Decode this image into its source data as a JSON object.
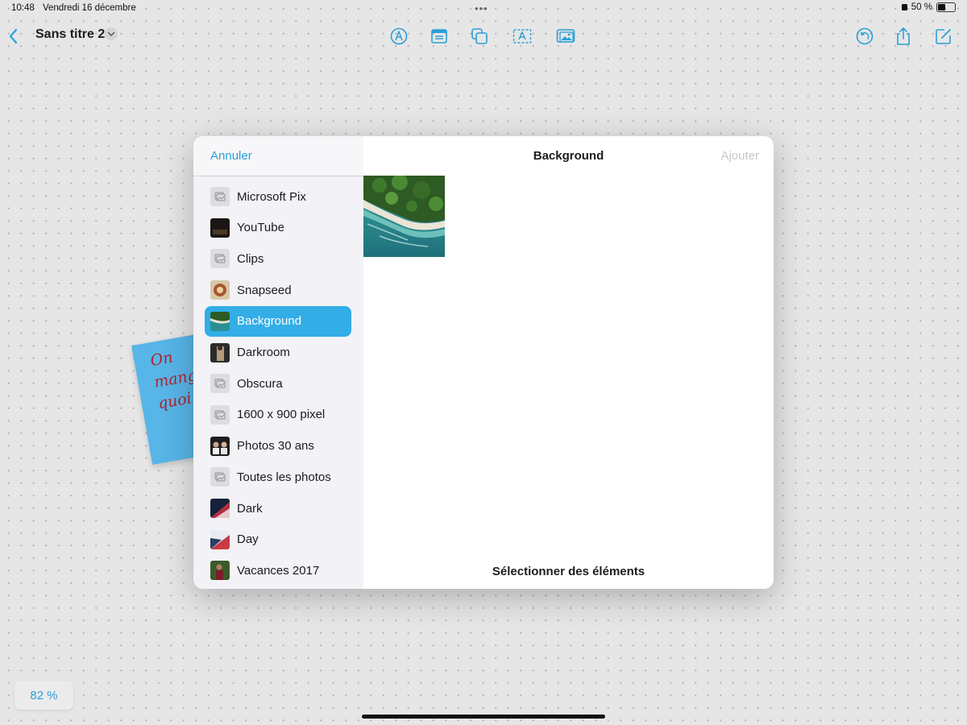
{
  "status": {
    "time": "10:48",
    "date": "Vendredi 16 décembre",
    "battery": "50 %",
    "battery_level": 0.5
  },
  "toolbar": {
    "doc_title": "Sans titre 2",
    "icons": [
      "back-chevron-icon",
      "title-menu-chevron-icon",
      "pen-markup-icon",
      "sticky-note-icon",
      "shapes-icon",
      "text-box-icon",
      "insert-media-icon",
      "history-icon",
      "share-icon",
      "new-board-icon"
    ]
  },
  "sticky_note": {
    "text": "On\nmange\nquoi"
  },
  "picker": {
    "cancel_label": "Annuler",
    "title": "Background",
    "add_label": "Ajouter",
    "select_label": "Sélectionner des éléments",
    "albums": [
      {
        "label": "Microsoft Pix",
        "thumb": "placeholder"
      },
      {
        "label": "YouTube",
        "thumb": "dark"
      },
      {
        "label": "Clips",
        "thumb": "placeholder"
      },
      {
        "label": "Snapseed",
        "thumb": "food"
      },
      {
        "label": "Background",
        "thumb": "beach",
        "selected": true
      },
      {
        "label": "Darkroom",
        "thumb": "portrait"
      },
      {
        "label": "Obscura",
        "thumb": "placeholder"
      },
      {
        "label": "1600 x 900 pixel",
        "thumb": "placeholder"
      },
      {
        "label": "Photos 30 ans",
        "thumb": "group"
      },
      {
        "label": "Toutes les photos",
        "thumb": "placeholder"
      },
      {
        "label": "Dark",
        "thumb": "wall-dark"
      },
      {
        "label": "Day",
        "thumb": "wall-day"
      },
      {
        "label": "Vacances 2017",
        "thumb": "vacation"
      }
    ]
  },
  "zoom": {
    "label": "82 %"
  },
  "colors": {
    "accent": "#2a9fd8",
    "selected_row": "#33ade6",
    "sticky": "#58b5e8",
    "ink": "#b0222a",
    "disabled": "#c7c7cc"
  }
}
